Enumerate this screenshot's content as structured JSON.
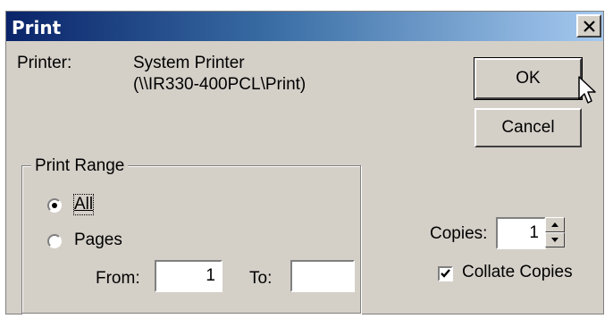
{
  "window": {
    "title": "Print",
    "close_icon": "close-icon"
  },
  "printer": {
    "label": "Printer:",
    "name": "System Printer",
    "path": "(\\\\IR330-400PCL\\Print)"
  },
  "buttons": {
    "ok": "OK",
    "cancel": "Cancel"
  },
  "print_range": {
    "legend": "Print Range",
    "options": [
      {
        "label": "All",
        "selected": true
      },
      {
        "label": "Pages",
        "selected": false
      }
    ],
    "from_label": "From:",
    "from_value": "1",
    "to_label": "To:",
    "to_value": ""
  },
  "copies": {
    "label": "Copies:",
    "value": "1"
  },
  "collate": {
    "label": "Collate Copies",
    "checked": true
  },
  "colors": {
    "title_start": "#0a246a",
    "title_end": "#a6caf0",
    "face": "#d4d0c8"
  }
}
